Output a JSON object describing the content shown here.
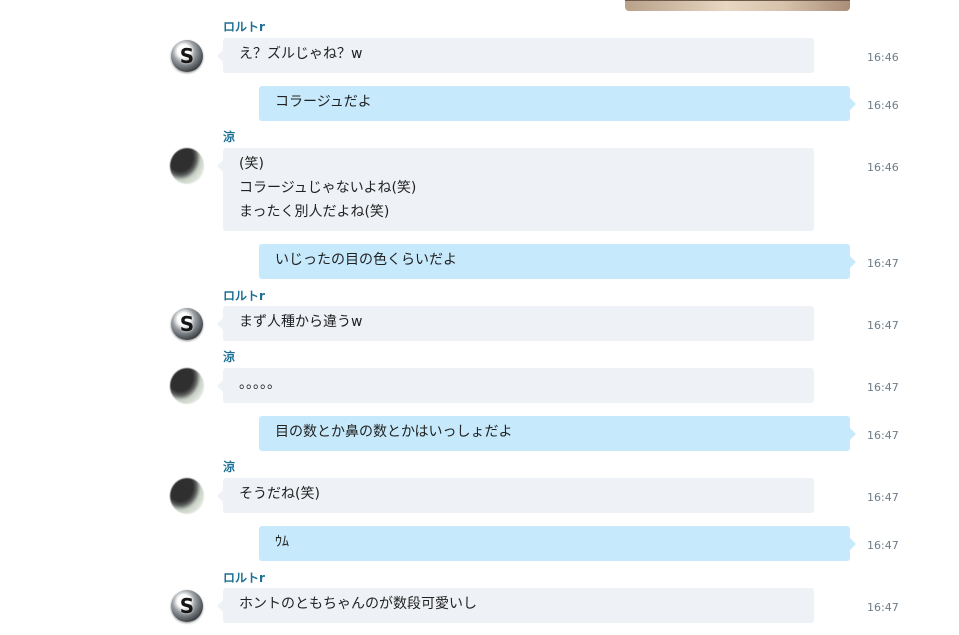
{
  "conversation": {
    "messages": [
      {
        "sender": "ロルトr",
        "text": "え？ズルじゃね？w",
        "time": "16:46",
        "dir": "in"
      },
      {
        "text": "コラージュだよ",
        "time": "16:46",
        "dir": "out"
      },
      {
        "sender": "涼",
        "lines": [
          "(笑)",
          "コラージュじゃないよね(笑)",
          "まったく別人だよね(笑)"
        ],
        "time": "16:46",
        "dir": "in"
      },
      {
        "text": "いじったの目の色くらいだよ",
        "time": "16:47",
        "dir": "out"
      },
      {
        "sender": "ロルトr",
        "text": "まず人種から違うw",
        "time": "16:47",
        "dir": "in"
      },
      {
        "sender": "涼",
        "text": "。。。。。",
        "time": "16:47",
        "dir": "in"
      },
      {
        "text": "目の数とか鼻の数とかはいっしょだよ",
        "time": "16:47",
        "dir": "out"
      },
      {
        "sender": "涼",
        "text": "そうだね(笑)",
        "time": "16:47",
        "dir": "in"
      },
      {
        "text": "ｳﾑ",
        "time": "16:47",
        "dir": "out"
      },
      {
        "sender": "ロルトr",
        "text": "ホントのともちゃんのが数段可愛いし",
        "time": "16:47",
        "dir": "in"
      }
    ]
  },
  "icons": {
    "skype": "skype-icon",
    "photo": "user-photo"
  },
  "colors": {
    "incoming_bubble": "#eef1f6",
    "outgoing_bubble": "#c6e9fb",
    "sender_name": "#1c6f93",
    "timestamp": "#6c7c88"
  }
}
